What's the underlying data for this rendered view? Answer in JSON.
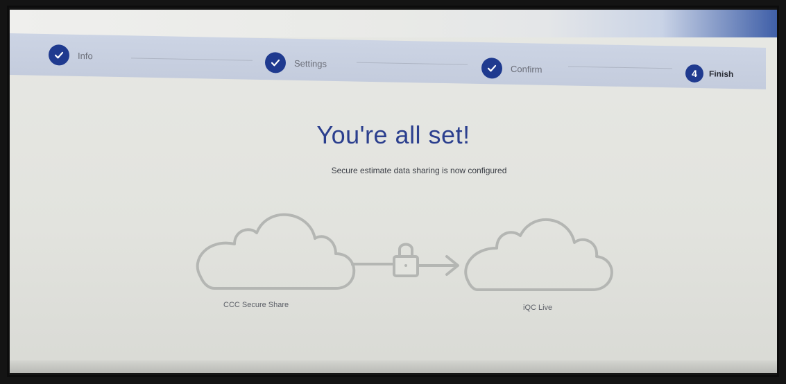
{
  "stepper": {
    "steps": [
      {
        "label": "Info",
        "state": "complete"
      },
      {
        "label": "Settings",
        "state": "complete"
      },
      {
        "label": "Confirm",
        "state": "complete"
      },
      {
        "label": "Finish",
        "state": "current",
        "number": "4"
      }
    ]
  },
  "main": {
    "title": "You're all set!",
    "subtitle": "Secure estimate data sharing is now configured"
  },
  "illustration": {
    "source_label": "CCC Secure Share",
    "target_label": "iQC Live",
    "connector_icon": "lock-icon"
  },
  "colors": {
    "accent": "#1f3a8f",
    "title": "#2b3f8e",
    "stepper_bg": "#c7cfdf",
    "line_art": "#b4b6b3"
  }
}
